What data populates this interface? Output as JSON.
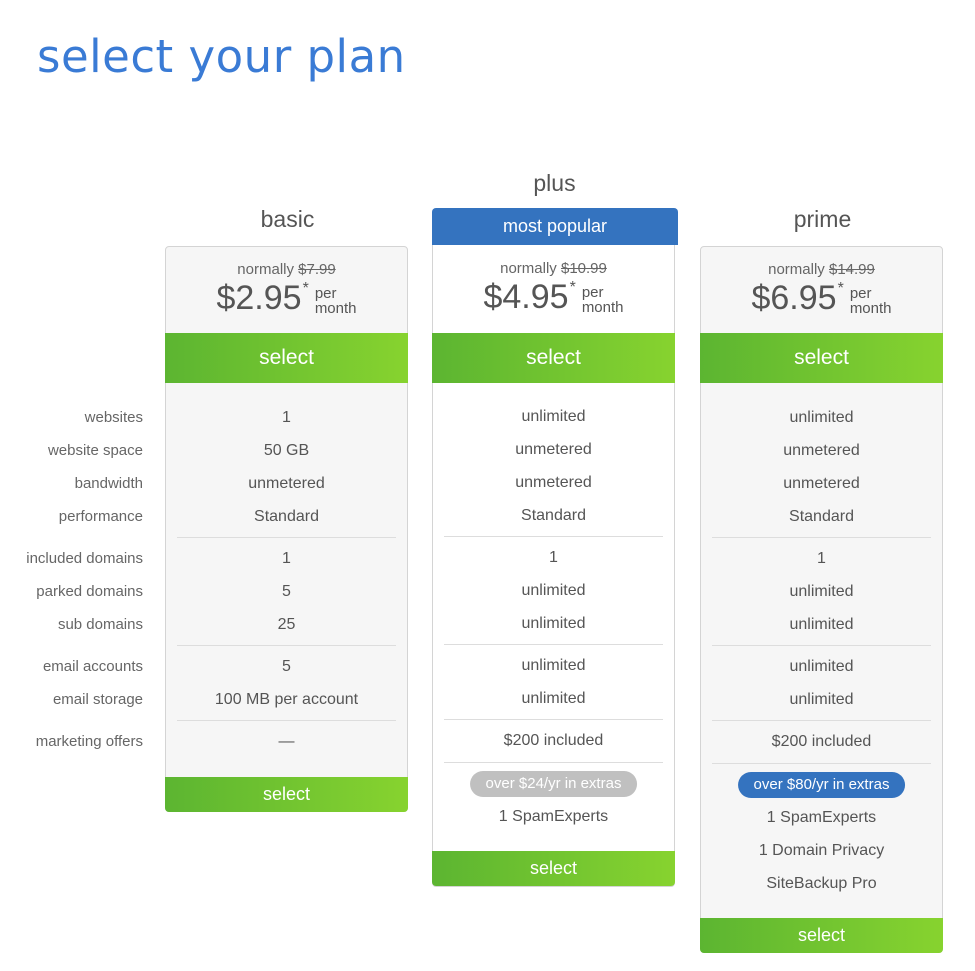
{
  "page": {
    "title": "select your plan"
  },
  "features": {
    "labels": [
      "websites",
      "website space",
      "bandwidth",
      "performance",
      "included domains",
      "parked domains",
      "sub domains",
      "email accounts",
      "email storage",
      "marketing offers"
    ]
  },
  "plans": [
    {
      "name": "basic",
      "normally_label": "normally",
      "normal_price": "$7.99",
      "price": "$2.95",
      "asterisk": "*",
      "per": "per",
      "month": "month",
      "select_label": "select",
      "values": [
        "1",
        "50 GB",
        "unmetered",
        "Standard",
        "1",
        "5",
        "25",
        "5",
        "100 MB per account",
        "—"
      ],
      "extras_badge": null,
      "extras": []
    },
    {
      "name": "plus",
      "badge": "most popular",
      "normally_label": "normally",
      "normal_price": "$10.99",
      "price": "$4.95",
      "asterisk": "*",
      "per": "per",
      "month": "month",
      "select_label": "select",
      "values": [
        "unlimited",
        "unmetered",
        "unmetered",
        "Standard",
        "1",
        "unlimited",
        "unlimited",
        "unlimited",
        "unlimited",
        "$200 included"
      ],
      "extras_badge": "over $24/yr in extras",
      "extras": [
        "1 SpamExperts"
      ]
    },
    {
      "name": "prime",
      "normally_label": "normally",
      "normal_price": "$14.99",
      "price": "$6.95",
      "asterisk": "*",
      "per": "per",
      "month": "month",
      "select_label": "select",
      "values": [
        "unlimited",
        "unmetered",
        "unmetered",
        "Standard",
        "1",
        "unlimited",
        "unlimited",
        "unlimited",
        "unlimited",
        "$200 included"
      ],
      "extras_badge": "over $80/yr in extras",
      "extras": [
        "1 SpamExperts",
        "1 Domain Privacy",
        "SiteBackup Pro"
      ]
    }
  ],
  "colors": {
    "title": "#3a7bd5",
    "popular": "#3473bf",
    "select_start": "#5cb531",
    "select_end": "#87d32f",
    "pill_gray": "#c0c0c0"
  }
}
